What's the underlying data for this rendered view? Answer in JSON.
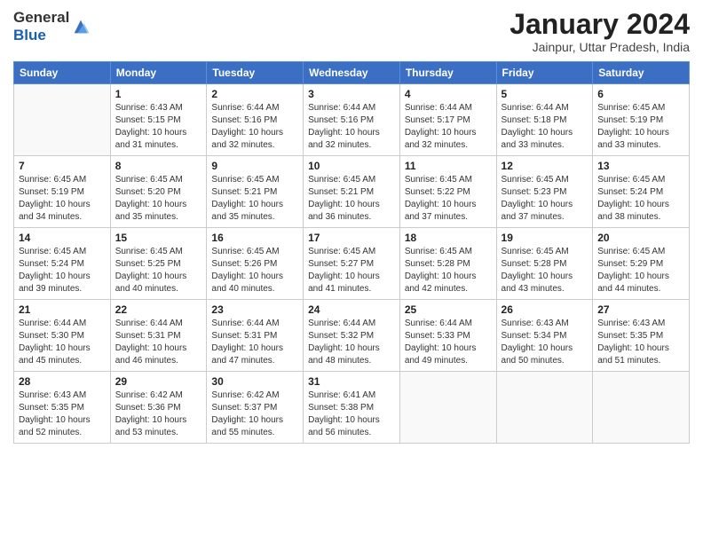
{
  "logo": {
    "general": "General",
    "blue": "Blue"
  },
  "title": "January 2024",
  "subtitle": "Jainpur, Uttar Pradesh, India",
  "days_header": [
    "Sunday",
    "Monday",
    "Tuesday",
    "Wednesday",
    "Thursday",
    "Friday",
    "Saturday"
  ],
  "weeks": [
    [
      {
        "day": "",
        "sunrise": "",
        "sunset": "",
        "daylight": ""
      },
      {
        "day": "1",
        "sunrise": "Sunrise: 6:43 AM",
        "sunset": "Sunset: 5:15 PM",
        "daylight": "Daylight: 10 hours and 31 minutes."
      },
      {
        "day": "2",
        "sunrise": "Sunrise: 6:44 AM",
        "sunset": "Sunset: 5:16 PM",
        "daylight": "Daylight: 10 hours and 32 minutes."
      },
      {
        "day": "3",
        "sunrise": "Sunrise: 6:44 AM",
        "sunset": "Sunset: 5:16 PM",
        "daylight": "Daylight: 10 hours and 32 minutes."
      },
      {
        "day": "4",
        "sunrise": "Sunrise: 6:44 AM",
        "sunset": "Sunset: 5:17 PM",
        "daylight": "Daylight: 10 hours and 32 minutes."
      },
      {
        "day": "5",
        "sunrise": "Sunrise: 6:44 AM",
        "sunset": "Sunset: 5:18 PM",
        "daylight": "Daylight: 10 hours and 33 minutes."
      },
      {
        "day": "6",
        "sunrise": "Sunrise: 6:45 AM",
        "sunset": "Sunset: 5:19 PM",
        "daylight": "Daylight: 10 hours and 33 minutes."
      }
    ],
    [
      {
        "day": "7",
        "sunrise": "Sunrise: 6:45 AM",
        "sunset": "Sunset: 5:19 PM",
        "daylight": "Daylight: 10 hours and 34 minutes."
      },
      {
        "day": "8",
        "sunrise": "Sunrise: 6:45 AM",
        "sunset": "Sunset: 5:20 PM",
        "daylight": "Daylight: 10 hours and 35 minutes."
      },
      {
        "day": "9",
        "sunrise": "Sunrise: 6:45 AM",
        "sunset": "Sunset: 5:21 PM",
        "daylight": "Daylight: 10 hours and 35 minutes."
      },
      {
        "day": "10",
        "sunrise": "Sunrise: 6:45 AM",
        "sunset": "Sunset: 5:21 PM",
        "daylight": "Daylight: 10 hours and 36 minutes."
      },
      {
        "day": "11",
        "sunrise": "Sunrise: 6:45 AM",
        "sunset": "Sunset: 5:22 PM",
        "daylight": "Daylight: 10 hours and 37 minutes."
      },
      {
        "day": "12",
        "sunrise": "Sunrise: 6:45 AM",
        "sunset": "Sunset: 5:23 PM",
        "daylight": "Daylight: 10 hours and 37 minutes."
      },
      {
        "day": "13",
        "sunrise": "Sunrise: 6:45 AM",
        "sunset": "Sunset: 5:24 PM",
        "daylight": "Daylight: 10 hours and 38 minutes."
      }
    ],
    [
      {
        "day": "14",
        "sunrise": "Sunrise: 6:45 AM",
        "sunset": "Sunset: 5:24 PM",
        "daylight": "Daylight: 10 hours and 39 minutes."
      },
      {
        "day": "15",
        "sunrise": "Sunrise: 6:45 AM",
        "sunset": "Sunset: 5:25 PM",
        "daylight": "Daylight: 10 hours and 40 minutes."
      },
      {
        "day": "16",
        "sunrise": "Sunrise: 6:45 AM",
        "sunset": "Sunset: 5:26 PM",
        "daylight": "Daylight: 10 hours and 40 minutes."
      },
      {
        "day": "17",
        "sunrise": "Sunrise: 6:45 AM",
        "sunset": "Sunset: 5:27 PM",
        "daylight": "Daylight: 10 hours and 41 minutes."
      },
      {
        "day": "18",
        "sunrise": "Sunrise: 6:45 AM",
        "sunset": "Sunset: 5:28 PM",
        "daylight": "Daylight: 10 hours and 42 minutes."
      },
      {
        "day": "19",
        "sunrise": "Sunrise: 6:45 AM",
        "sunset": "Sunset: 5:28 PM",
        "daylight": "Daylight: 10 hours and 43 minutes."
      },
      {
        "day": "20",
        "sunrise": "Sunrise: 6:45 AM",
        "sunset": "Sunset: 5:29 PM",
        "daylight": "Daylight: 10 hours and 44 minutes."
      }
    ],
    [
      {
        "day": "21",
        "sunrise": "Sunrise: 6:44 AM",
        "sunset": "Sunset: 5:30 PM",
        "daylight": "Daylight: 10 hours and 45 minutes."
      },
      {
        "day": "22",
        "sunrise": "Sunrise: 6:44 AM",
        "sunset": "Sunset: 5:31 PM",
        "daylight": "Daylight: 10 hours and 46 minutes."
      },
      {
        "day": "23",
        "sunrise": "Sunrise: 6:44 AM",
        "sunset": "Sunset: 5:31 PM",
        "daylight": "Daylight: 10 hours and 47 minutes."
      },
      {
        "day": "24",
        "sunrise": "Sunrise: 6:44 AM",
        "sunset": "Sunset: 5:32 PM",
        "daylight": "Daylight: 10 hours and 48 minutes."
      },
      {
        "day": "25",
        "sunrise": "Sunrise: 6:44 AM",
        "sunset": "Sunset: 5:33 PM",
        "daylight": "Daylight: 10 hours and 49 minutes."
      },
      {
        "day": "26",
        "sunrise": "Sunrise: 6:43 AM",
        "sunset": "Sunset: 5:34 PM",
        "daylight": "Daylight: 10 hours and 50 minutes."
      },
      {
        "day": "27",
        "sunrise": "Sunrise: 6:43 AM",
        "sunset": "Sunset: 5:35 PM",
        "daylight": "Daylight: 10 hours and 51 minutes."
      }
    ],
    [
      {
        "day": "28",
        "sunrise": "Sunrise: 6:43 AM",
        "sunset": "Sunset: 5:35 PM",
        "daylight": "Daylight: 10 hours and 52 minutes."
      },
      {
        "day": "29",
        "sunrise": "Sunrise: 6:42 AM",
        "sunset": "Sunset: 5:36 PM",
        "daylight": "Daylight: 10 hours and 53 minutes."
      },
      {
        "day": "30",
        "sunrise": "Sunrise: 6:42 AM",
        "sunset": "Sunset: 5:37 PM",
        "daylight": "Daylight: 10 hours and 55 minutes."
      },
      {
        "day": "31",
        "sunrise": "Sunrise: 6:41 AM",
        "sunset": "Sunset: 5:38 PM",
        "daylight": "Daylight: 10 hours and 56 minutes."
      },
      {
        "day": "",
        "sunrise": "",
        "sunset": "",
        "daylight": ""
      },
      {
        "day": "",
        "sunrise": "",
        "sunset": "",
        "daylight": ""
      },
      {
        "day": "",
        "sunrise": "",
        "sunset": "",
        "daylight": ""
      }
    ]
  ]
}
